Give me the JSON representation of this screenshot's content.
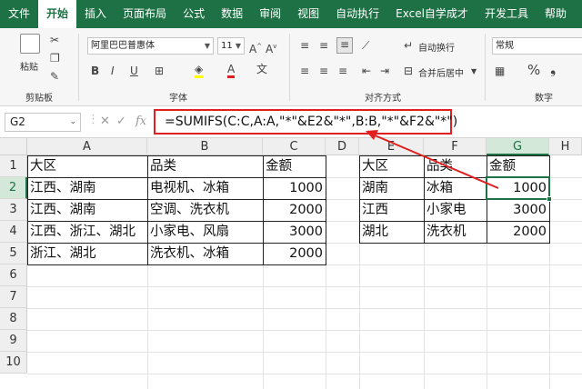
{
  "menu": {
    "items": [
      "文件",
      "开始",
      "插入",
      "页面布局",
      "公式",
      "数据",
      "审阅",
      "视图",
      "自动执行",
      "Excel自学成才",
      "开发工具",
      "帮助"
    ],
    "active_index": 1
  },
  "ribbon": {
    "clipboard": {
      "paste_label": "粘贴",
      "group_label": "剪贴板"
    },
    "font": {
      "font_name": "阿里巴巴普惠体",
      "font_size": "11",
      "group_label": "字体",
      "bold": "B",
      "italic": "I",
      "underline": "U"
    },
    "alignment": {
      "wrap_label": "自动换行",
      "merge_label": "合并后居中",
      "group_label": "对齐方式"
    },
    "number": {
      "format": "常规",
      "group_label": "数字"
    }
  },
  "formula_bar": {
    "name_box": "G2",
    "fx": "fx",
    "formula": "=SUMIFS(C:C,A:A,\"*\"&E2&\"*\",B:B,\"*\"&F2&\"*\")"
  },
  "sheet": {
    "columns": [
      "A",
      "B",
      "C",
      "D",
      "E",
      "F",
      "G",
      "H"
    ],
    "rows": [
      "1",
      "2",
      "3",
      "4",
      "5",
      "6",
      "7",
      "8",
      "9",
      "10"
    ],
    "selected_column": "G",
    "selected_row": "2",
    "left_table": [
      [
        "大区",
        "品类",
        "金额"
      ],
      [
        "江西、湖南",
        "电视机、冰箱",
        "1000"
      ],
      [
        "江西、湖南",
        "空调、洗衣机",
        "2000"
      ],
      [
        "江西、浙江、湖北",
        "小家电、风扇",
        "3000"
      ],
      [
        "浙江、湖北",
        "洗衣机、冰箱",
        "2000"
      ]
    ],
    "right_table": [
      [
        "大区",
        "品类",
        "金额"
      ],
      [
        "湖南",
        "冰箱",
        "1000"
      ],
      [
        "江西",
        "小家电",
        "3000"
      ],
      [
        "湖北",
        "洗衣机",
        "2000"
      ]
    ]
  },
  "colors": {
    "accent": "#1e7145",
    "highlight": "#e02020"
  }
}
